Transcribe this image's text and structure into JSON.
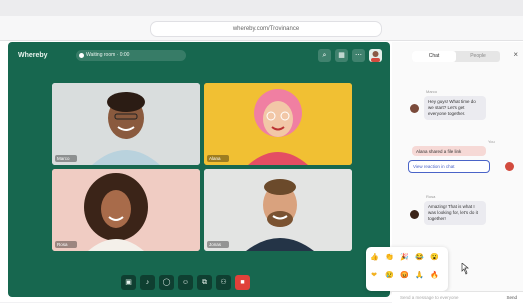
{
  "browser": {
    "url": "whereby.com/Trovinance"
  },
  "app": {
    "brand": "Whereby",
    "meeting_pill": "Waiting room · 0:00",
    "top_icons": [
      "search-icon",
      "grid-icon",
      "more-icon"
    ]
  },
  "participants": [
    {
      "name": "Marco"
    },
    {
      "name": "Alana"
    },
    {
      "name": "Rosa"
    },
    {
      "name": "Jonas"
    }
  ],
  "controls": [
    {
      "icon": "camera-icon",
      "glyph": "▣"
    },
    {
      "icon": "mic-icon",
      "glyph": "♪"
    },
    {
      "icon": "chat-icon",
      "glyph": "◯"
    },
    {
      "icon": "reactions-icon",
      "glyph": "☺"
    },
    {
      "icon": "share-icon",
      "glyph": "⧉"
    },
    {
      "icon": "people-icon",
      "glyph": "⚇"
    },
    {
      "icon": "leave-icon",
      "glyph": "■"
    }
  ],
  "panel": {
    "tab_chat": "Chat",
    "tab_people": "People",
    "messages": [
      {
        "sender": "Marco",
        "text": "Hey guys! What time do we start? Let's get everyone together."
      },
      {
        "sender": "You",
        "text": "Alana shared a file link",
        "action": "View reaction in chat"
      },
      {
        "sender": "Rosa",
        "text": "Amazing! That is what I was looking for, let's do it together!"
      }
    ],
    "input_placeholder": "Send a message to everyone",
    "send_label": "Send"
  },
  "emoji_picker": {
    "row1": [
      "👍",
      "👏",
      "🎉",
      "😂",
      "😮"
    ],
    "row2": [
      "❤",
      "😢",
      "😡",
      "🙏",
      "🔥"
    ]
  },
  "colors": {
    "app_bg": "#17674f",
    "control_bg": "#0f3f31",
    "leave": "#e0413a",
    "accent": "#4a64c8"
  }
}
